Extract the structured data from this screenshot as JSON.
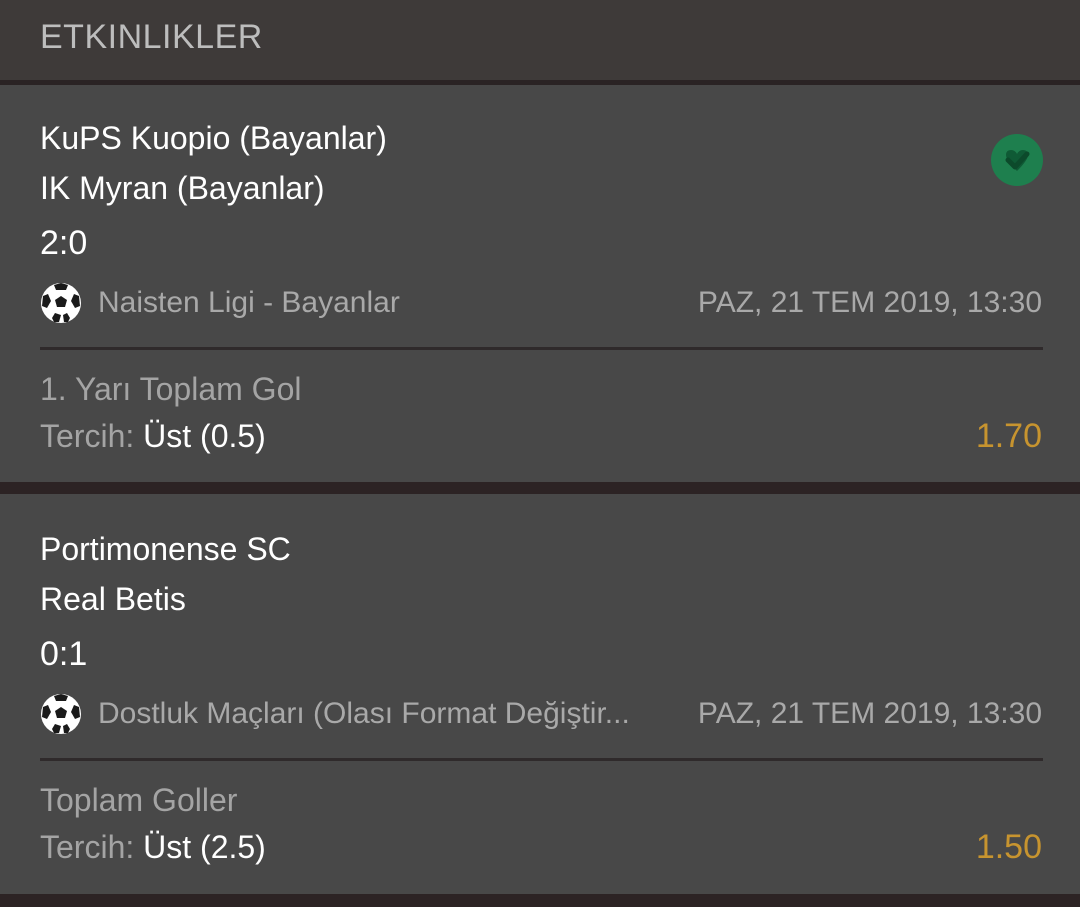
{
  "header": {
    "title": "ETKINLIKLER"
  },
  "events": [
    {
      "home": "KuPS Kuopio (Bayanlar)",
      "away": "IK Myran (Bayanlar)",
      "score": "2:0",
      "sport_icon": "soccer-ball-icon",
      "league": "Naisten Ligi - Bayanlar",
      "date": "PAZ, 21 TEM 2019, 13:30",
      "market": "1. Yarı Toplam Gol",
      "pick_label": "Tercih:",
      "pick_value": "Üst (0.5)",
      "odds": "1.70",
      "status_icon": "check-circle-icon",
      "status_color": "#1e7f4e"
    },
    {
      "home": "Portimonense SC",
      "away": "Real Betis",
      "score": "0:1",
      "sport_icon": "soccer-ball-icon",
      "league": "Dostluk Maçları (Olası Format Değiştir...",
      "date": "PAZ, 21 TEM 2019, 13:30",
      "market": "Toplam Goller",
      "pick_label": "Tercih:",
      "pick_value": "Üst (2.5)",
      "odds": "1.50"
    }
  ],
  "colors": {
    "background": "#2d2628",
    "card": "#484848",
    "odds": "#c7942f",
    "text_secondary": "#a9a9a9"
  }
}
